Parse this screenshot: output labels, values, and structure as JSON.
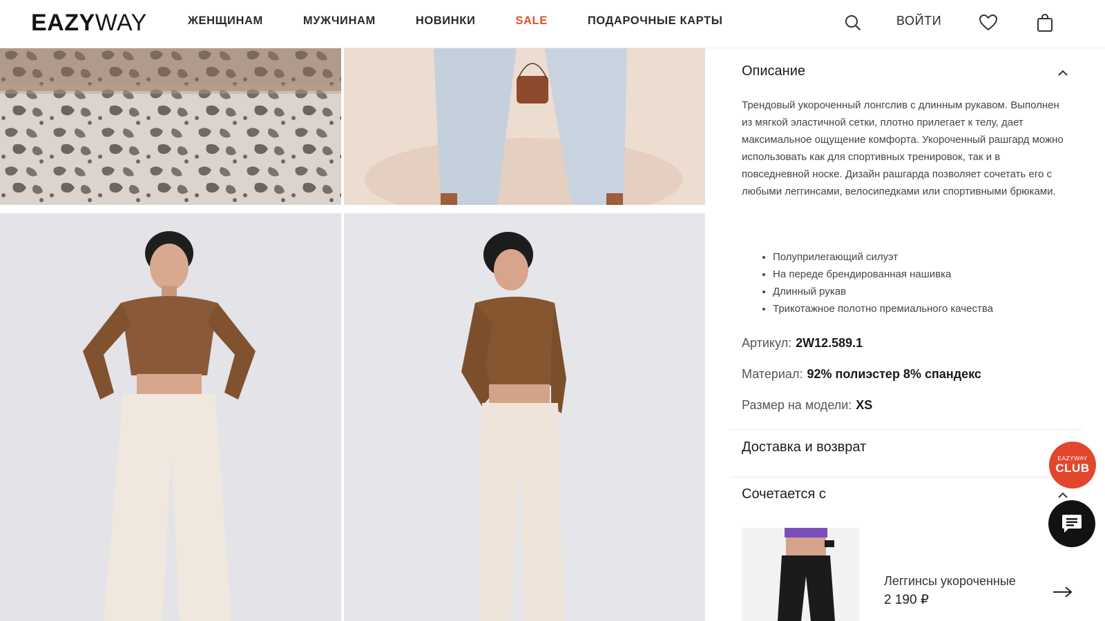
{
  "header": {
    "logo_bold": "EAZY",
    "logo_light": "WAY",
    "nav": [
      "ЖЕНЩИНАМ",
      "МУЖЧИНАМ",
      "НОВИНКИ",
      "SALE",
      "ПОДАРОЧНЫЕ КАРТЫ"
    ],
    "login_label": "ВОЙТИ",
    "icons": [
      "search-icon",
      "heart-icon",
      "bag-icon"
    ]
  },
  "colors": {
    "sale": "#d9542b",
    "club_badge": "#e2472c",
    "chat_button": "#121212"
  },
  "description": {
    "title": "Описание",
    "text": "Трендовый укороченный лонгслив с длинным рукавом. Выполнен из мягкой эластичной сетки, плотно прилегает к телу, дает максимальное ощущение комфорта. Укороченный рашгард можно использовать как для спортивных тренировок, так и в повседневной носке. Дизайн рашгарда позволяет сочетать его с любыми леггинсами, велосипедками или спортивными брюками.",
    "bullets": [
      "Полуприлегающий силуэт",
      "На переде брендированная нашивка",
      "Длинный рукав",
      "Трикотажное полотно премиального качества"
    ],
    "article_label": "Артикул:",
    "article_value": "2W12.589.1",
    "material_label": "Материал:",
    "material_value": "92% полиэстер 8% спандекс",
    "size_label": "Размер на модели:",
    "size_value": "XS"
  },
  "delivery": {
    "title": "Доставка и возврат"
  },
  "combine": {
    "title": "Сочетается с",
    "item_name": "Леггинсы укороченные",
    "item_price": "2 190 ₽"
  },
  "club_badge": {
    "line1": "EAZYWAY",
    "line2": "CLUB"
  }
}
